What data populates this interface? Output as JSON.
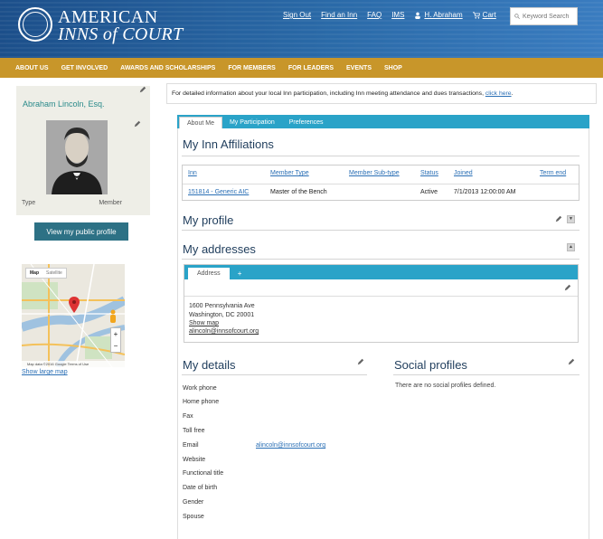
{
  "header": {
    "logo_line1": "AMERICAN",
    "logo_line2": "INNS of COURT",
    "links": [
      "Sign Out",
      "Find an Inn",
      "FAQ",
      "IMS"
    ],
    "user_link": "H. Abraham",
    "cart_link": "Cart",
    "search_placeholder": "Keyword Search"
  },
  "mainnav": [
    "ABOUT US",
    "GET INVOLVED",
    "AWARDS AND SCHOLARSHIPS",
    "FOR MEMBERS",
    "FOR LEADERS",
    "EVENTS",
    "SHOP"
  ],
  "sidebar": {
    "name": "Abraham Lincoln, Esq.",
    "type_label": "Type",
    "type_value": "Member",
    "view_profile_button": "View my public profile",
    "map": {
      "tab_map": "Map",
      "tab_satellite": "Satellite",
      "footer_text": "Map data ©2016 Google   Terms of Use",
      "zoom_in": "+",
      "zoom_out": "−"
    },
    "show_large_map": "Show large map"
  },
  "info_bar": {
    "text": "For detailed information about your local Inn participation, including Inn meeting attendance and dues transactions, ",
    "link": "click here",
    "suffix": "."
  },
  "tabs": [
    "About Me",
    "My Participation",
    "Preferences"
  ],
  "affiliations": {
    "title": "My Inn Affiliations",
    "columns": [
      "Inn",
      "Member Type",
      "Member Sub-type",
      "Status",
      "Joined",
      "Term end"
    ],
    "rows": [
      {
        "inn": "151814 - Generic AIC",
        "member_type": "Master of the Bench",
        "sub_type": "",
        "status": "Active",
        "joined": "7/1/2013 12:00:00 AM",
        "term_end": ""
      }
    ]
  },
  "profile": {
    "title": "My profile"
  },
  "addresses": {
    "title": "My addresses",
    "tab_label": "Address",
    "add_tab": "+",
    "street": "1600 Pennsylvania Ave",
    "city_state_zip": "Washington, DC 20001",
    "show_map": "Show map",
    "email": "alincoln@innsofcourt.org"
  },
  "details": {
    "title": "My details",
    "fields": [
      "Work phone",
      "Home phone",
      "Fax",
      "Toll free",
      "Email",
      "Website",
      "Functional title",
      "Date of birth",
      "Gender",
      "Spouse"
    ],
    "email_value": "alincoln@innsofcourt.org"
  },
  "social": {
    "title": "Social profiles",
    "empty_text": "There are no social profiles defined."
  }
}
